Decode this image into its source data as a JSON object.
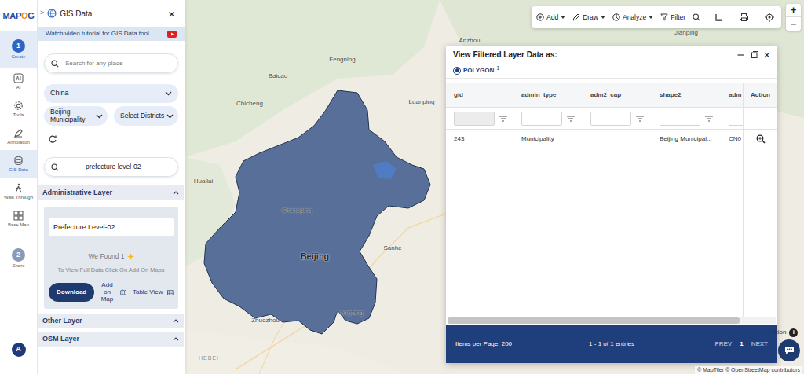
{
  "logo": {
    "main": "MAP",
    "mark": "O",
    "end": "G"
  },
  "rail": {
    "items": [
      {
        "kind": "step",
        "number": "1",
        "label": "Create",
        "selected": true
      },
      {
        "kind": "tool",
        "label": "AI",
        "selected": false
      },
      {
        "kind": "tool",
        "label": "Tools",
        "selected": false
      },
      {
        "kind": "tool",
        "label": "Annotation",
        "selected": false
      },
      {
        "kind": "tool",
        "label": "GIS Data",
        "selected": true
      },
      {
        "kind": "tool",
        "label": "Walk Through",
        "selected": false
      },
      {
        "kind": "tool",
        "label": "Base Map",
        "selected": false
      },
      {
        "kind": "step",
        "number": "2",
        "label": "Share",
        "selected": false
      }
    ],
    "avatar": "A"
  },
  "panel": {
    "chevron": ">",
    "title": "GIS Data",
    "close": "×",
    "tutorial": "Watch video tutorial for GIS Data tool",
    "place_search": {
      "placeholder": "Search for any place"
    },
    "country": "China",
    "province": "Beijing Municipality",
    "district": "Select Districts",
    "layer_search": {
      "value": "prefecture level-02"
    },
    "sections": [
      "Administrative Layer",
      "Other Layer",
      "OSM Layer"
    ],
    "result": {
      "layer": "Prefecture Level-02",
      "found": "We Found 1",
      "hint": "To View Full Data Click On Add On Maps",
      "download": "Download",
      "add_on_map": "Add on Map",
      "table_view": "Table View"
    }
  },
  "toolbar": {
    "menus": [
      {
        "label": "Add",
        "dropdown": true
      },
      {
        "label": "Draw",
        "dropdown": true
      },
      {
        "label": "Analyze",
        "dropdown": true
      },
      {
        "label": "Filter",
        "dropdown": false
      }
    ]
  },
  "zoom": {
    "in": "+",
    "out": "−"
  },
  "map": {
    "labels": [
      {
        "text": "Anzhou",
        "kind": "town"
      },
      {
        "text": "Jianping",
        "kind": "town"
      },
      {
        "text": "Fengning",
        "kind": "town"
      },
      {
        "text": "Baicao",
        "kind": "town"
      },
      {
        "text": "Chicheng",
        "kind": "town"
      },
      {
        "text": "Luanping",
        "kind": "town"
      },
      {
        "text": "Huailai",
        "kind": "town"
      },
      {
        "text": "Changping",
        "kind": "town"
      },
      {
        "text": "Beijing",
        "kind": "capital"
      },
      {
        "text": "Sanhe",
        "kind": "town"
      },
      {
        "text": "Zhuozhou",
        "kind": "town"
      },
      {
        "text": "Langfang",
        "kind": "town"
      },
      {
        "text": "HEBEI",
        "kind": "province"
      }
    ],
    "attribution": "© MapTiler © OpenStreetMap contributors",
    "attribution_cut": "ation",
    "info": "i"
  },
  "table_window": {
    "title": "View Filtered Layer Data as:",
    "close": "×",
    "geometry_tabs": [
      {
        "label": "POLYGON",
        "count": "1",
        "selected": true
      }
    ],
    "columns": [
      "gid",
      "admin_type",
      "adm2_cap",
      "shape2",
      "adm"
    ],
    "action_column": "Action",
    "filters": [
      {
        "disabled": true
      },
      {
        "disabled": false
      },
      {
        "disabled": false
      },
      {
        "disabled": false
      },
      {
        "disabled": false
      }
    ],
    "rows": [
      [
        "243",
        "Municipality",
        "",
        "Beijing Municipal...",
        "CN0"
      ]
    ],
    "scroll_level": 0.89,
    "footer": {
      "items_per_page": "Items per Page: 200",
      "range": "1 - 1 of 1 entries",
      "prev": {
        "label": "PREV",
        "disabled": true
      },
      "page": "1",
      "next": {
        "label": "NEXT",
        "disabled": true
      }
    }
  }
}
